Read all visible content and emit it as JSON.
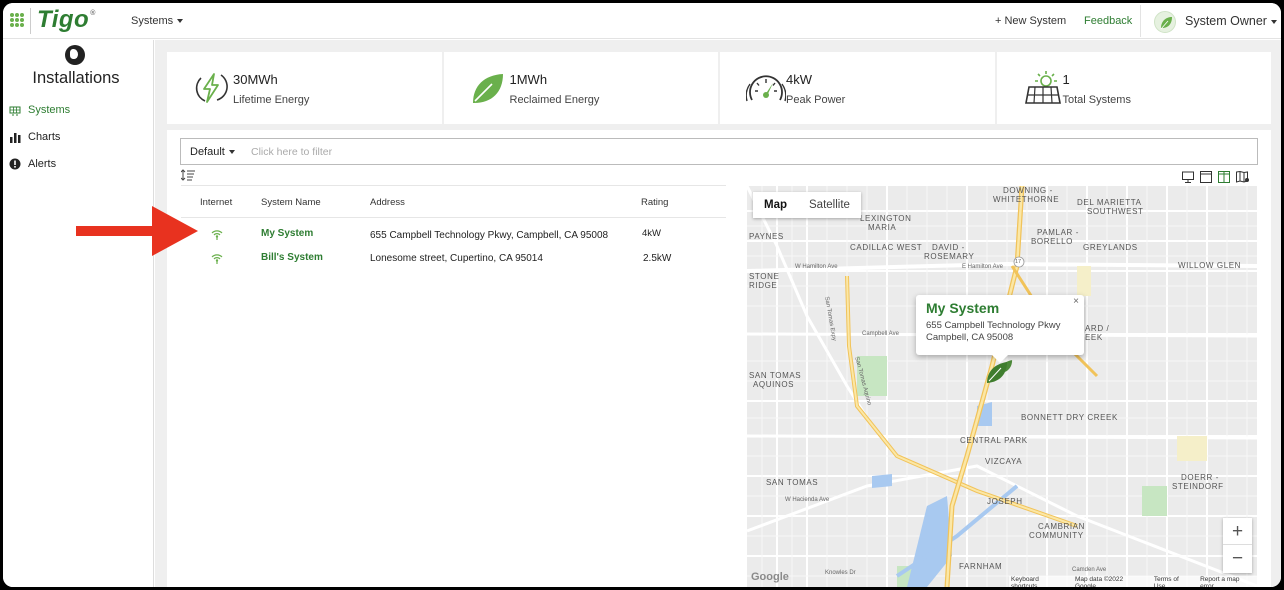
{
  "header": {
    "brand": "Tigo",
    "brand_mark": "®",
    "nav_systems": "Systems",
    "new_system": "+ New System",
    "feedback": "Feedback",
    "user": "System Owner"
  },
  "sidebar": {
    "title": "Installations",
    "items": [
      {
        "label": "Systems",
        "icon": "solar-panel-icon",
        "active": true
      },
      {
        "label": "Charts",
        "icon": "bar-chart-icon",
        "active": false
      },
      {
        "label": "Alerts",
        "icon": "alert-icon",
        "active": false
      }
    ]
  },
  "stats": [
    {
      "value": "30MWh",
      "label": "Lifetime Energy",
      "icon": "lightning-icon"
    },
    {
      "value": "1MWh",
      "label": "Reclaimed Energy",
      "icon": "leaf-icon"
    },
    {
      "value": "4kW",
      "label": "Peak Power",
      "icon": "gauge-icon"
    },
    {
      "value": "1",
      "label": "Total Systems",
      "icon": "solar-panel-sun-icon"
    }
  ],
  "filter": {
    "preset": "Default",
    "placeholder": "Click here to filter"
  },
  "table": {
    "columns": [
      "Internet",
      "System Name",
      "Address",
      "Rating"
    ],
    "rows": [
      {
        "name": "My System",
        "address": "655 Campbell Technology Pkwy, Campbell, CA 95008",
        "rating": "4kW"
      },
      {
        "name": "Bill's System",
        "address": "Lonesome street, Cupertino, CA 95014",
        "rating": "2.5kW"
      }
    ]
  },
  "map": {
    "tabs": [
      "Map",
      "Satellite"
    ],
    "active_tab": "Map",
    "info": {
      "title": "My System",
      "line1": "655 Campbell Technology Pkwy",
      "line2": "Campbell, CA 95008",
      "close": "×"
    },
    "zoom_in": "+",
    "zoom_out": "−",
    "google": "Google",
    "attribution": [
      "Keyboard shortcuts",
      "Map data ©2022 Google",
      "Terms of Use",
      "Report a map error"
    ],
    "labels": {
      "downing": "DOWNING -",
      "whitethorne": "WHITETHORNE",
      "del_marietta": "DEL MARIETTA",
      "southwest": "SOUTHWEST",
      "lexington": "LEXINGTON",
      "maria": "MARIA",
      "paynes": "PAYNES",
      "pamlar": "PAMLAR -",
      "borello": "BORELLO",
      "cadillac": "CADILLAC WEST",
      "david": "DAVID -",
      "rosemary": "ROSEMARY",
      "greylands": "GREYLANDS",
      "willow_glen": "WILLOW GLEN",
      "stone": "STONE",
      "ridge": "RIDGE",
      "ard": "ARD /",
      "eek": "EEK",
      "san_tomas_aquinos_1": "SAN TOMAS",
      "san_tomas_aquinos_2": "AQUINOS",
      "bonnett": "BONNETT DRY CREEK",
      "central_park": "CENTRAL PARK",
      "vizcaya": "VIZCAYA",
      "san_tomas": "SAN TOMAS",
      "doerr": "DOERR -",
      "steindorf": "STEINDORF",
      "joseph": "JOSEPH",
      "cambrian": "CAMBRIAN",
      "community": "COMMUNITY",
      "farnham": "FARNHAM",
      "w_hamilton": "W Hamilton Ave",
      "e_hamilton": "E Hamilton Ave",
      "campbell_ave": "Campbell Ave",
      "san_tomas_expy": "San Tomas Expy",
      "san_tomas_aquino": "San Tomas Aquino",
      "hacienda": "W Hacienda Ave",
      "knowles": "Knowles Dr",
      "camden": "Camden Ave",
      "route": "17"
    }
  },
  "colors": {
    "brand_green": "#2e7d32",
    "accent_green": "#6ab04c",
    "arrow_red": "#e8321f"
  }
}
